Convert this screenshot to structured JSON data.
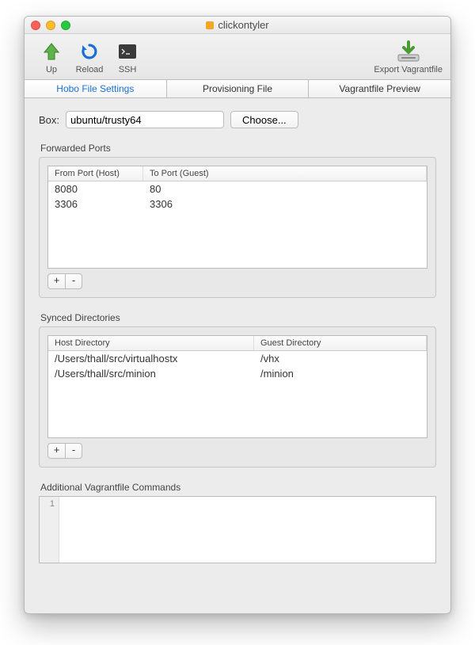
{
  "window": {
    "title": "clickontyler"
  },
  "toolbar": {
    "up": "Up",
    "reload": "Reload",
    "ssh": "SSH",
    "export": "Export Vagrantfile"
  },
  "tabs": {
    "hobo": "Hobo File Settings",
    "provisioning": "Provisioning File",
    "preview": "Vagrantfile Preview"
  },
  "box": {
    "label": "Box:",
    "value": "ubuntu/trusty64",
    "choose": "Choose..."
  },
  "forwarded": {
    "title": "Forwarded Ports",
    "headers": {
      "from": "From Port (Host)",
      "to": "To Port (Guest)"
    },
    "rows": [
      {
        "from": "8080",
        "to": "80"
      },
      {
        "from": "3306",
        "to": "3306"
      }
    ]
  },
  "synced": {
    "title": "Synced Directories",
    "headers": {
      "host": "Host Directory",
      "guest": "Guest Directory"
    },
    "rows": [
      {
        "host": "/Users/thall/src/virtualhostx",
        "guest": "/vhx"
      },
      {
        "host": "/Users/thall/src/minion",
        "guest": "/minion"
      }
    ]
  },
  "commands": {
    "title": "Additional Vagrantfile Commands",
    "line_number": "1"
  },
  "buttons": {
    "plus": "+",
    "minus": "-"
  }
}
